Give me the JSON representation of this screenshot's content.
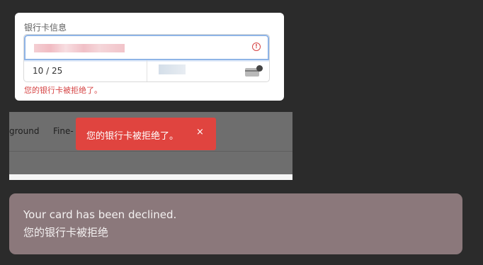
{
  "card_form": {
    "section_label": "银行卡信息",
    "expiry_value": "10 / 25",
    "error_text": "您的银行卡被拒绝了。"
  },
  "page_strip": {
    "nav_item_1": "ground",
    "nav_item_2": "Fine-"
  },
  "toast": {
    "message": "您的银行卡被拒绝了。",
    "close_symbol": "×",
    "background_color": "#e0443f"
  },
  "message_bubble": {
    "line_1": "Your card has been declined.",
    "line_2": "您的银行卡被拒绝"
  },
  "icons": {
    "error": "error-icon",
    "card": "card-icon",
    "close": "close-icon"
  }
}
